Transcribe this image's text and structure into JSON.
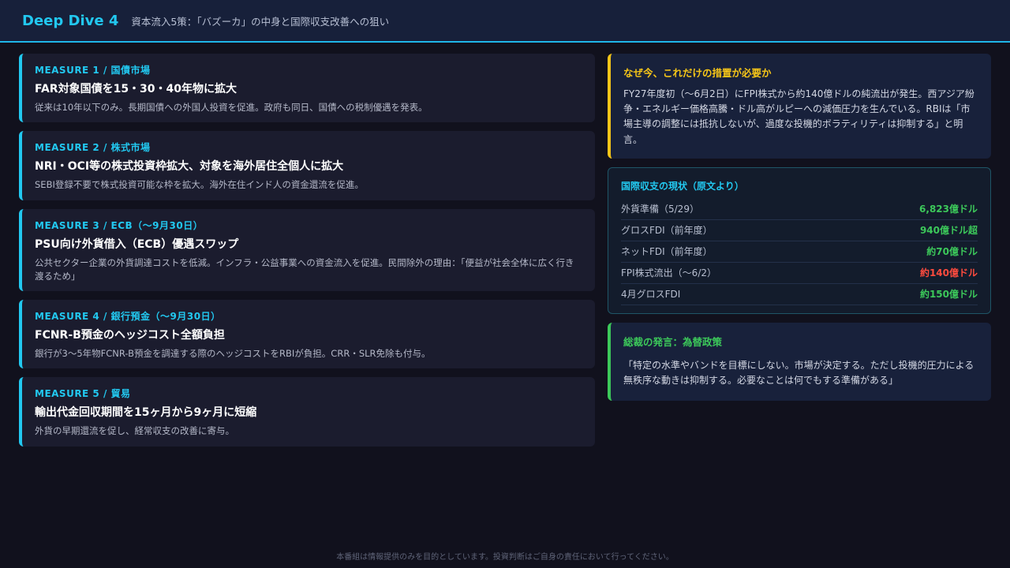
{
  "header": {
    "title": "Deep Dive 4",
    "subtitle": "資本流入5策：「バズーカ」の中身と国際収支改善への狙い"
  },
  "measures": [
    {
      "tag": "MEASURE 1 / 国債市場",
      "title": "FAR対象国債を15・30・40年物に拡大",
      "desc": "従来は10年以下のみ。長期国債への外国人投資を促進。政府も同日、国債への税制優遇を発表。"
    },
    {
      "tag": "MEASURE 2 / 株式市場",
      "title": "NRI・OCI等の株式投資枠拡大、対象を海外居住全個人に拡大",
      "desc": "SEBI登録不要で株式投資可能な枠を拡大。海外在住インド人の資金還流を促進。"
    },
    {
      "tag": "MEASURE 3 / ECB（〜9月30日）",
      "title": "PSU向け外貨借入（ECB）優遇スワップ",
      "desc": "公共セクター企業の外貨調達コストを低減。インフラ・公益事業への資金流入を促進。民間除外の理由：「便益が社会全体に広く行き渡るため」"
    },
    {
      "tag": "MEASURE 4 / 銀行預金（〜9月30日）",
      "title": "FCNR-B預金のヘッジコスト全額負担",
      "desc": "銀行が3〜5年物FCNR-B預金を調達する際のヘッジコストをRBIが負担。CRR・SLR免除も付与。"
    },
    {
      "tag": "MEASURE 5 / 貿易",
      "title": "輸出代金回収期間を15ヶ月から9ヶ月に短縮",
      "desc": "外貨の早期還流を促し、経常収支の改善に寄与。"
    }
  ],
  "why": {
    "title": "なぜ今、これだけの措置が必要か",
    "body": "FY27年度初（〜6月2日）にFPI株式から約140億ドルの純流出が発生。西アジア紛争・エネルギー価格高騰・ドル高がルピーへの減価圧力を生んでいる。RBIは「市場主導の調整には抵抗しないが、過度な投機的ボラティリティは抑制する」と明言。"
  },
  "bop": {
    "title": "国際収支の現状（原文より）",
    "rows": [
      {
        "label": "外貨準備（5/29）",
        "value": "6,823億ドル",
        "tone": "pos"
      },
      {
        "label": "グロスFDI（前年度）",
        "value": "940億ドル超",
        "tone": "pos"
      },
      {
        "label": "ネットFDI（前年度）",
        "value": "約70億ドル",
        "tone": "pos"
      },
      {
        "label": "FPI株式流出（〜6/2）",
        "value": "約140億ドル",
        "tone": "neg"
      },
      {
        "label": "4月グロスFDI",
        "value": "約150億ドル",
        "tone": "pos"
      }
    ]
  },
  "quote": {
    "title": "総裁の発言：為替政策",
    "body": "「特定の水準やバンドを目標にしない。市場が決定する。ただし投機的圧力による無秩序な動きは抑制する。必要なことは何でもする準備がある」"
  },
  "footer": "本番組は情報提供のみを目的としています。投資判断はご自身の責任において行ってください。",
  "colors": {
    "accent": "#22c8f0",
    "warning": "#f5c518",
    "positive": "#3cc85a",
    "negative": "#ff4b3e"
  }
}
